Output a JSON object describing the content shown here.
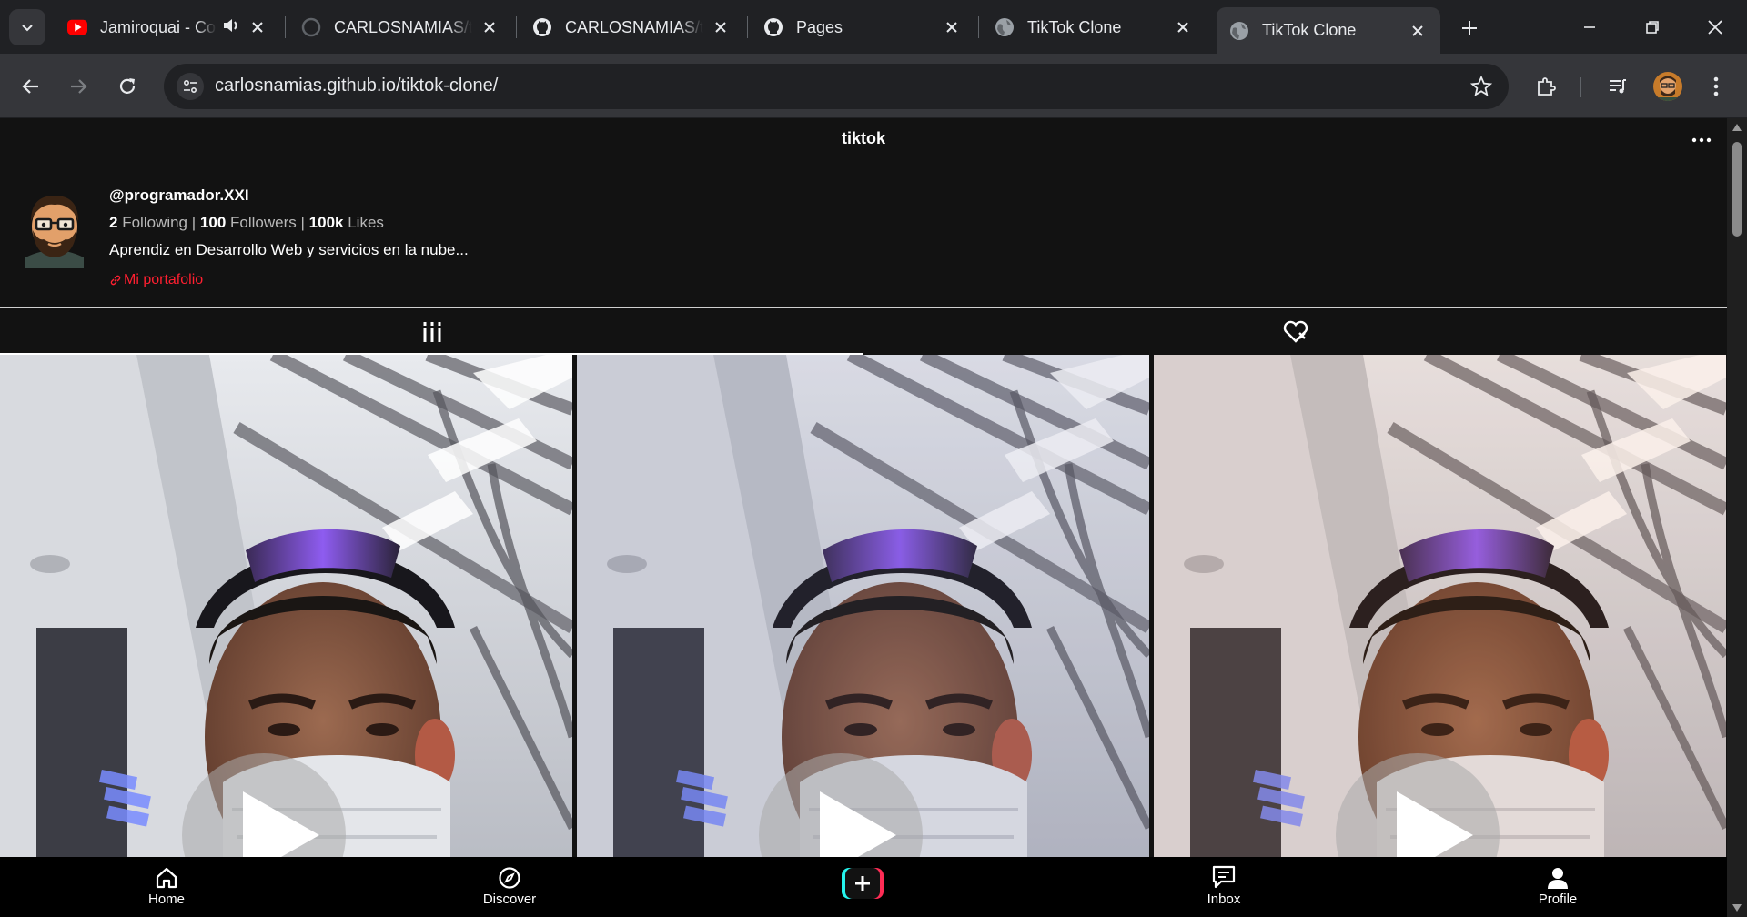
{
  "browser": {
    "tabs": [
      {
        "title": "Jamiroquai - Cosmic Girl",
        "favicon": "youtube-icon",
        "audio": true
      },
      {
        "title": "CARLOSNAMIAS/tiktok-clone",
        "favicon": "github-loading-icon"
      },
      {
        "title": "CARLOSNAMIAS/tiktok-clone",
        "favicon": "github-icon"
      },
      {
        "title": "Pages",
        "favicon": "github-icon"
      },
      {
        "title": "TikTok Clone",
        "favicon": "globe-icon"
      },
      {
        "title": "TikTok Clone",
        "favicon": "globe-icon",
        "active": true
      }
    ],
    "url": "carlosnamias.github.io/tiktok-clone/",
    "colors": {
      "frame": "#202124",
      "toolbar": "#35363a",
      "text": "#e8eaed"
    }
  },
  "page": {
    "title": "tiktok",
    "profile": {
      "username": "@programador.XXI",
      "following_count": "2",
      "following_label": "Following",
      "followers_count": "100",
      "followers_label": "Followers",
      "likes_count": "100k",
      "likes_label": "Likes",
      "separator": "|",
      "bio": "Aprendiz en Desarrollo Web y servicios en la nube...",
      "link_text": "Mi portafolio"
    },
    "tabs": [
      {
        "icon": "grid-bars-icon",
        "active": true
      },
      {
        "icon": "liked-heart-icon",
        "active": false
      }
    ],
    "videos": [
      {
        "tint": "none"
      },
      {
        "tint": "cool"
      },
      {
        "tint": "warm"
      }
    ],
    "bottom_nav": [
      {
        "label": "Home",
        "icon": "home-icon"
      },
      {
        "label": "Discover",
        "icon": "compass-icon"
      },
      {
        "label": "",
        "icon": "create-plus-icon"
      },
      {
        "label": "Inbox",
        "icon": "inbox-icon"
      },
      {
        "label": "Profile",
        "icon": "person-icon"
      }
    ],
    "colors": {
      "background": "#121212",
      "accent": "#ff1f30",
      "create_cyan": "#25f4ee",
      "create_pink": "#fe2c55"
    }
  }
}
